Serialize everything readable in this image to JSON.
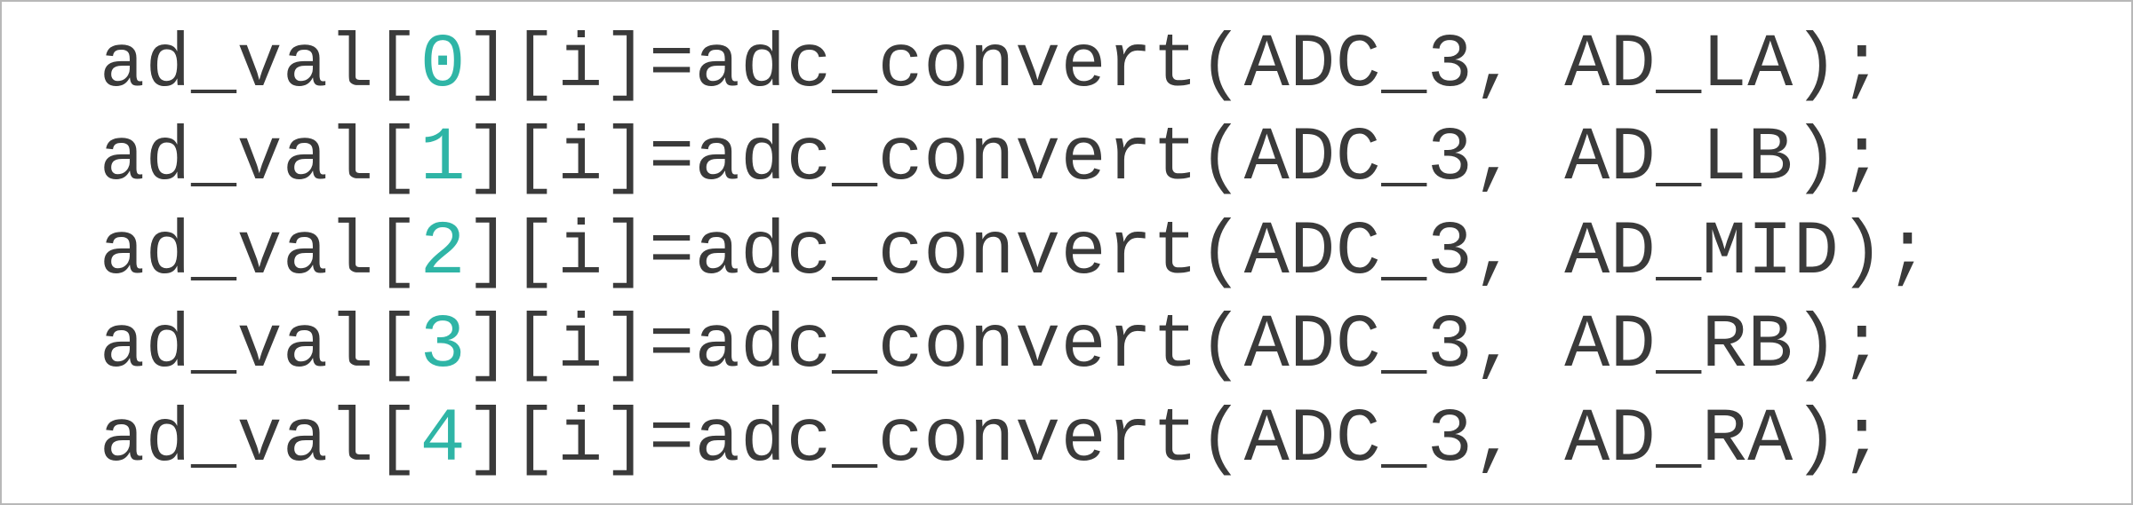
{
  "code": {
    "lines": [
      {
        "lhs": "ad_val[",
        "idx": "0",
        "rest": "][i]=adc_convert(ADC_3, AD_LA);"
      },
      {
        "lhs": "ad_val[",
        "idx": "1",
        "rest": "][i]=adc_convert(ADC_3, AD_LB);"
      },
      {
        "lhs": "ad_val[",
        "idx": "2",
        "rest": "][i]=adc_convert(ADC_3, AD_MID);"
      },
      {
        "lhs": "ad_val[",
        "idx": "3",
        "rest": "][i]=adc_convert(ADC_3, AD_RB);"
      },
      {
        "lhs": "ad_val[",
        "idx": "4",
        "rest": "][i]=adc_convert(ADC_3, AD_RA);"
      }
    ]
  }
}
